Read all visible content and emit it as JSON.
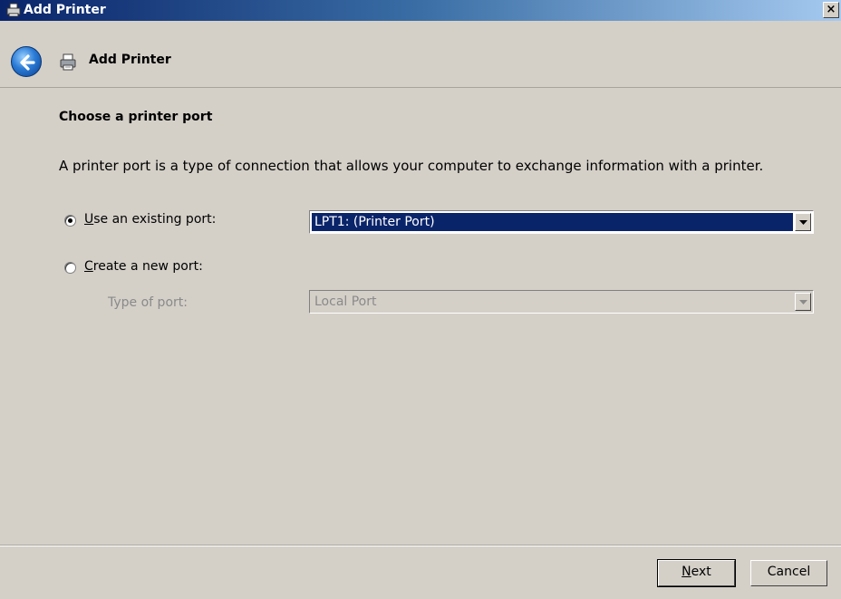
{
  "window": {
    "title": "Add Printer",
    "close_label": "×"
  },
  "nav": {
    "title": "Add Printer",
    "back_icon": "back-arrow-icon",
    "printer_icon": "printer-icon"
  },
  "page": {
    "heading": "Choose a printer port",
    "description": "A printer port is a type of connection that allows your computer to exchange information with a printer."
  },
  "options": {
    "existing_port": {
      "prefix": "U",
      "rest": "se an existing port:",
      "selected": true,
      "value": "LPT1: (Printer Port)"
    },
    "new_port": {
      "prefix": "C",
      "rest": "reate a new port:",
      "selected": false
    },
    "type_of_port": {
      "label": "Type of port:",
      "value": "Local Port",
      "enabled": false
    }
  },
  "buttons": {
    "next_prefix": "N",
    "next_rest": "ext",
    "cancel": "Cancel"
  },
  "colors": {
    "selection": "#0a246a",
    "dialog_bg": "#d4d0c8"
  }
}
